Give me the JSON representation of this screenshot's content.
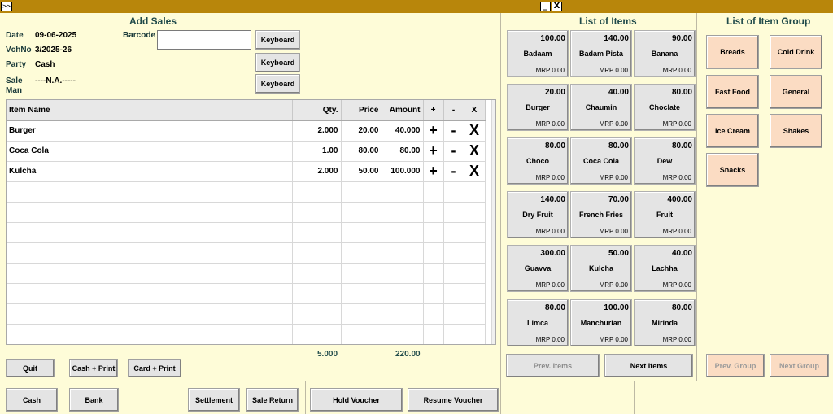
{
  "titlebar": {
    "left_button": ">>",
    "minimize": "_",
    "close": "X"
  },
  "add_sales": {
    "title": "Add Sales",
    "date_label": "Date",
    "date_value": "09-06-2025",
    "vchno_label": "VchNo",
    "vchno_value": "3/2025-26",
    "party_label": "Party",
    "party_value": "Cash",
    "saleman_label": "Sale",
    "saleman_label2": "Man",
    "saleman_value": "----N.A.-----",
    "barcode_label": "Barcode",
    "barcode_value": "",
    "keyboard_label": "Keyboard"
  },
  "grid": {
    "headers": [
      "Item Name",
      "Qty.",
      "Price",
      "Amount",
      "+",
      "-",
      "X"
    ],
    "rows": [
      {
        "name": "Burger",
        "qty": "2.000",
        "price": "20.00",
        "amount": "40.000",
        "plus": "+",
        "minus": "-",
        "del": "X"
      },
      {
        "name": "Coca Cola",
        "qty": "1.00",
        "price": "80.00",
        "amount": "80.00",
        "plus": "+",
        "minus": "-",
        "del": "X"
      },
      {
        "name": "Kulcha",
        "qty": "2.000",
        "price": "50.00",
        "amount": "100.000",
        "plus": "+",
        "minus": "-",
        "del": "X"
      }
    ],
    "total_qty": "5.000",
    "total_amount": "220.00"
  },
  "actions": {
    "quit": "Quit",
    "cash_print": "Cash + Print",
    "card_print": "Card + Print"
  },
  "bottom": {
    "cash": "Cash",
    "bank": "Bank",
    "settlement": "Settlement",
    "sale_return": "Sale Return",
    "hold_voucher": "Hold Voucher",
    "resume_voucher": "Resume Voucher"
  },
  "items": {
    "title": "List of Items",
    "list": [
      {
        "name": "Badaam",
        "price": "100.00",
        "mrp": "MRP  0.00"
      },
      {
        "name": "Badam Pista",
        "price": "140.00",
        "mrp": "MRP  0.00"
      },
      {
        "name": "Banana",
        "price": "90.00",
        "mrp": "MRP  0.00"
      },
      {
        "name": "Burger",
        "price": "20.00",
        "mrp": "MRP  0.00"
      },
      {
        "name": "Chaumin",
        "price": "40.00",
        "mrp": "MRP  0.00"
      },
      {
        "name": "Choclate",
        "price": "80.00",
        "mrp": "MRP  0.00"
      },
      {
        "name": "Choco",
        "price": "80.00",
        "mrp": "MRP  0.00"
      },
      {
        "name": "Coca Cola",
        "price": "80.00",
        "mrp": "MRP  0.00"
      },
      {
        "name": "Dew",
        "price": "80.00",
        "mrp": "MRP  0.00"
      },
      {
        "name": "Dry Fruit",
        "price": "140.00",
        "mrp": "MRP  0.00"
      },
      {
        "name": "French Fries",
        "price": "70.00",
        "mrp": "MRP  0.00"
      },
      {
        "name": "Fruit",
        "price": "400.00",
        "mrp": "MRP  0.00"
      },
      {
        "name": "Guavva",
        "price": "300.00",
        "mrp": "MRP  0.00"
      },
      {
        "name": "Kulcha",
        "price": "50.00",
        "mrp": "MRP  0.00"
      },
      {
        "name": "Lachha",
        "price": "40.00",
        "mrp": "MRP  0.00"
      },
      {
        "name": "Limca",
        "price": "80.00",
        "mrp": "MRP  0.00"
      },
      {
        "name": "Manchurian",
        "price": "100.00",
        "mrp": "MRP  0.00"
      },
      {
        "name": "Mirinda",
        "price": "80.00",
        "mrp": "MRP  0.00"
      }
    ],
    "prev": "Prev. Items",
    "next": "Next Items"
  },
  "groups": {
    "title": "List of Item Group",
    "list": [
      "Breads",
      "Cold Drink",
      "Fast Food",
      "General",
      "Ice Cream",
      "Shakes",
      "Snacks"
    ],
    "prev": "Prev. Group",
    "next": "Next Group"
  }
}
